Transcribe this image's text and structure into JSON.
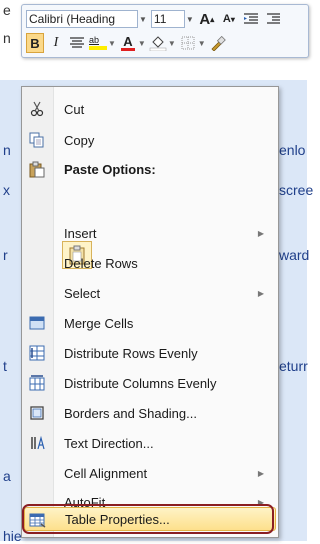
{
  "background_doc": {
    "fragments": [
      {
        "id": "frag-1",
        "text": "e"
      },
      {
        "id": "frag-2",
        "text": "n"
      },
      {
        "id": "frag-3",
        "text": "n"
      },
      {
        "id": "frag-4",
        "text": "x"
      },
      {
        "id": "frag-5",
        "text": "r"
      },
      {
        "id": "frag-6",
        "text": "t"
      },
      {
        "id": "frag-7",
        "text": "a"
      },
      {
        "id": "frag-8",
        "text": "hie"
      },
      {
        "id": "frag-9",
        "text": "enlo"
      },
      {
        "id": "frag-10",
        "text": "scree"
      },
      {
        "id": "frag-11",
        "text": "ward"
      },
      {
        "id": "frag-12",
        "text": "eturr"
      }
    ]
  },
  "mini_toolbar": {
    "font_name": "Calibri (Heading",
    "font_size": "11",
    "grow_font": "A",
    "shrink_font": "A",
    "bold": "B",
    "italic": "I",
    "highlight_label": "ab"
  },
  "menu": {
    "items": [
      {
        "id": "cut",
        "label": "Cut",
        "icon": "scissors-icon",
        "submenu": false
      },
      {
        "id": "copy",
        "label": "Copy",
        "icon": "copy-icon",
        "submenu": false
      },
      {
        "id": "paste-options",
        "label": "Paste Options:",
        "icon": "paste-icon",
        "submenu": false,
        "header": true
      },
      {
        "id": "insert",
        "label": "Insert",
        "icon": "",
        "submenu": true
      },
      {
        "id": "delete-rows",
        "label": "Delete Rows",
        "icon": "",
        "submenu": false
      },
      {
        "id": "select",
        "label": "Select",
        "icon": "",
        "submenu": true
      },
      {
        "id": "merge-cells",
        "label": "Merge Cells",
        "icon": "merge-cells-icon",
        "submenu": false
      },
      {
        "id": "distribute-rows",
        "label": "Distribute Rows Evenly",
        "icon": "distribute-rows-icon",
        "submenu": false
      },
      {
        "id": "distribute-columns",
        "label": "Distribute Columns Evenly",
        "icon": "distribute-columns-icon",
        "submenu": false
      },
      {
        "id": "borders-shading",
        "label": "Borders and Shading...",
        "icon": "borders-icon",
        "submenu": false
      },
      {
        "id": "text-direction",
        "label": "Text Direction...",
        "icon": "text-direction-icon",
        "submenu": false
      },
      {
        "id": "cell-alignment",
        "label": "Cell Alignment",
        "icon": "",
        "submenu": true
      },
      {
        "id": "autofit",
        "label": "AutoFit",
        "icon": "",
        "submenu": true
      },
      {
        "id": "table-properties",
        "label": "Table Properties...",
        "icon": "table-properties-icon",
        "submenu": false,
        "highlighted": true
      }
    ]
  },
  "colors": {
    "menu_bg": "#fafafa",
    "gutter": "#f0f0f0",
    "highlight": "#fde08c",
    "outline": "#8a1e22",
    "doc_band": "#dbe7f7"
  }
}
